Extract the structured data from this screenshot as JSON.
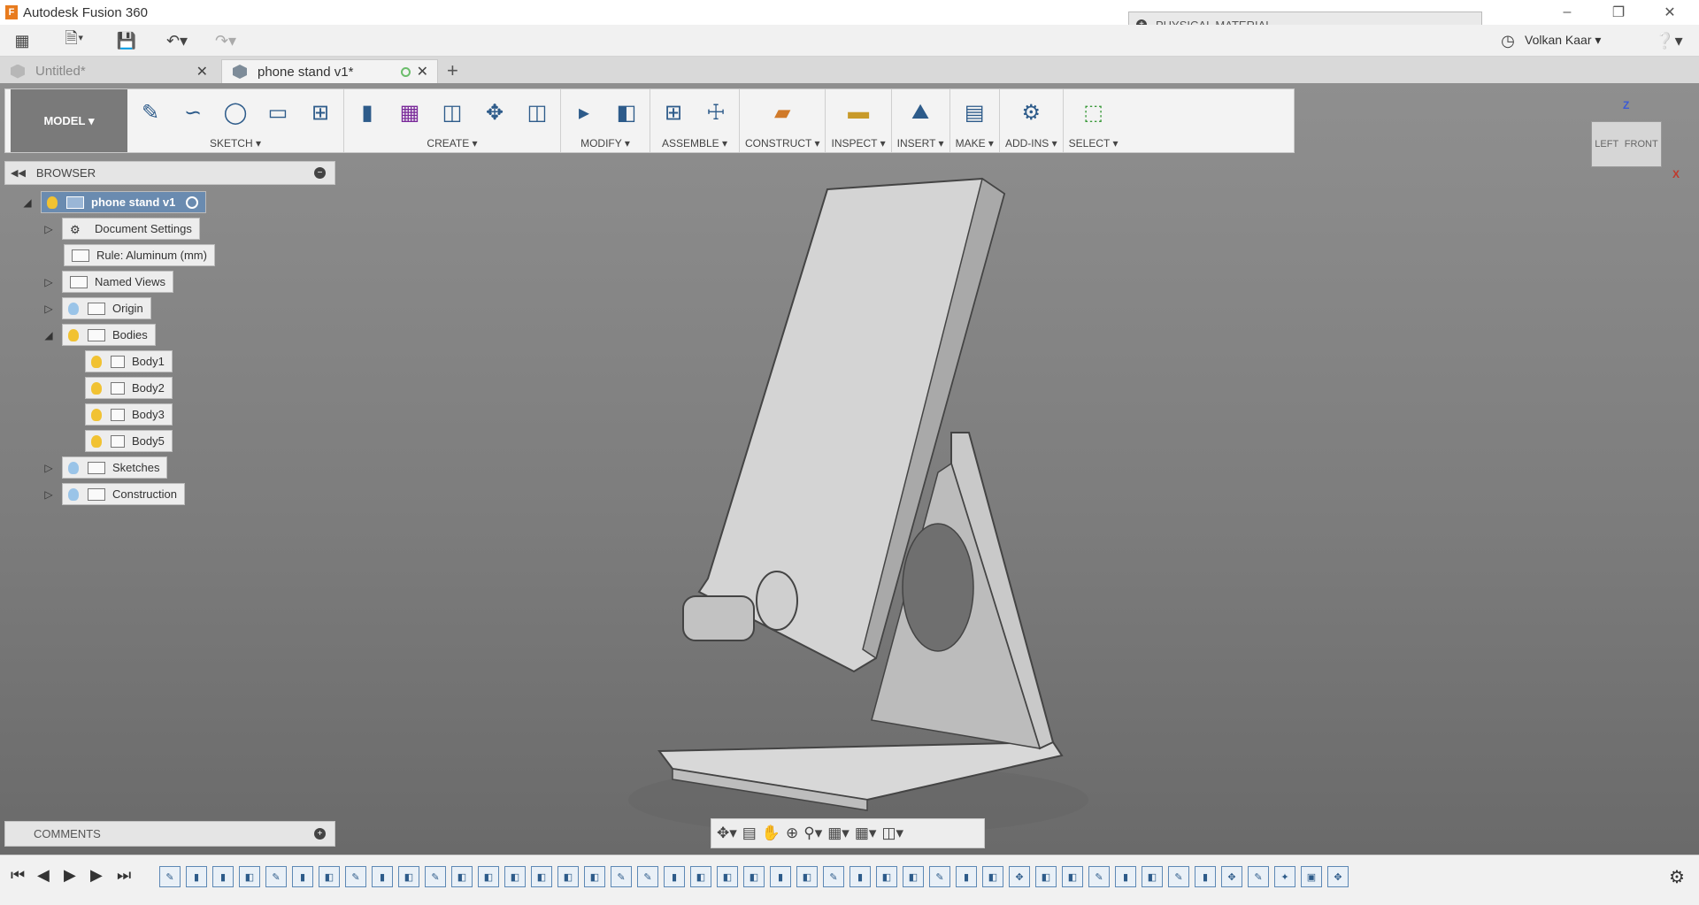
{
  "app_title": "Autodesk Fusion 360",
  "physical_material": "PHYSICAL MATERIAL",
  "user_name": "Volkan Kaar",
  "tabs": [
    {
      "label": "Untitled*"
    },
    {
      "label": "phone stand v1*"
    }
  ],
  "toolbar": {
    "workspace": "MODEL",
    "groups": [
      {
        "label": "SKETCH"
      },
      {
        "label": "CREATE"
      },
      {
        "label": "MODIFY"
      },
      {
        "label": "ASSEMBLE"
      },
      {
        "label": "CONSTRUCT"
      },
      {
        "label": "INSPECT"
      },
      {
        "label": "INSERT"
      },
      {
        "label": "MAKE"
      },
      {
        "label": "ADD-INS"
      },
      {
        "label": "SELECT"
      }
    ]
  },
  "viewcube": {
    "left": "LEFT",
    "front": "FRONT",
    "z": "Z",
    "x": "X"
  },
  "browser": {
    "title": "BROWSER",
    "root": "phone stand v1",
    "items": [
      "Document Settings",
      "Rule: Aluminum (mm)",
      "Named Views",
      "Origin",
      "Bodies",
      "Body1",
      "Body2",
      "Body3",
      "Body5",
      "Sketches",
      "Construction"
    ]
  },
  "comments": "COMMENTS",
  "colors": {
    "accent": "#2d5b8a",
    "viewport_top": "#8f8f8f",
    "viewport_bottom": "#6a6a6a"
  }
}
